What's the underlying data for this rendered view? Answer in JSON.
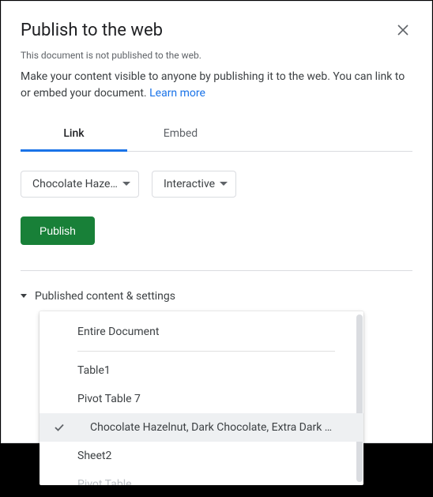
{
  "dialog": {
    "title": "Publish to the web",
    "subtitle": "This document is not published to the web.",
    "description": "Make your content visible to anyone by publishing it to the web. You can link to or embed your document. ",
    "learn_more": "Learn more"
  },
  "tabs": {
    "link": "Link",
    "embed": "Embed"
  },
  "selects": {
    "sheet": "Chocolate Hazel…",
    "mode": "Interactive"
  },
  "publish_button": "Publish",
  "expander": {
    "label": "Published content & settings"
  },
  "dropdown": {
    "entire": "Entire Document",
    "items": [
      "Table1",
      "Pivot Table 7",
      "Chocolate Hazelnut, Dark Chocolate, Extra Dark …",
      "Sheet2",
      "Pivot Table"
    ]
  }
}
